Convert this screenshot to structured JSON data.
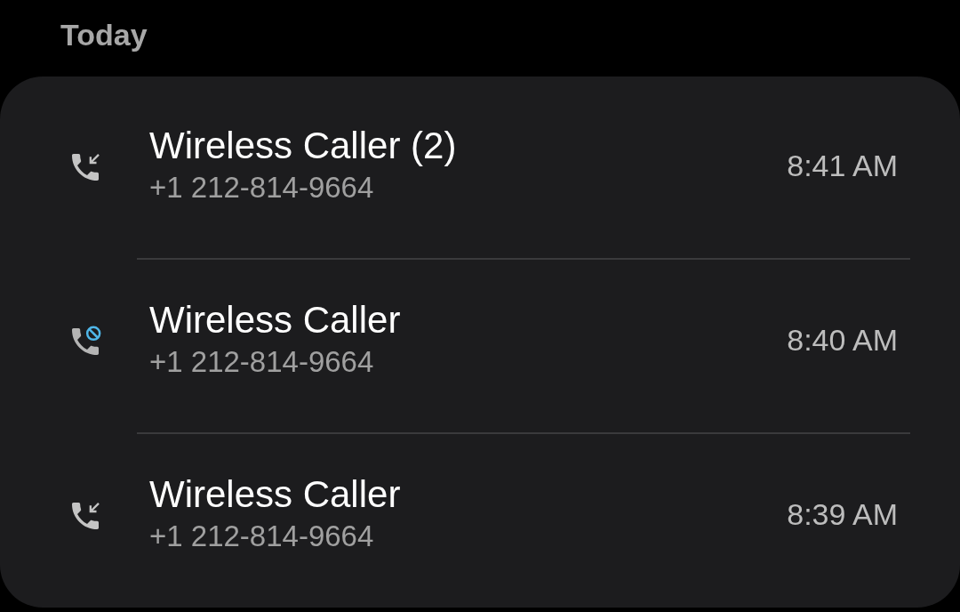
{
  "section": {
    "title": "Today"
  },
  "calls": [
    {
      "kind": "incoming",
      "name": "Wireless Caller (2)",
      "number": "+1 212-814-9664",
      "time": "8:41 AM"
    },
    {
      "kind": "blocked",
      "name": "Wireless Caller",
      "number": "+1 212-814-9664",
      "time": "8:40 AM"
    },
    {
      "kind": "incoming",
      "name": "Wireless Caller",
      "number": "+1 212-814-9664",
      "time": "8:39 AM"
    }
  ]
}
